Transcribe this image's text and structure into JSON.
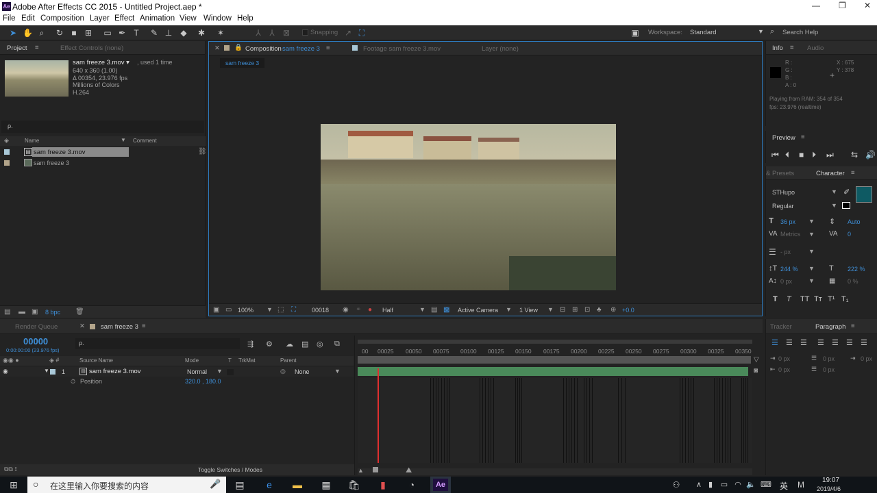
{
  "window": {
    "title": "Adobe After Effects CC 2015 - Untitled Project.aep *",
    "app_icon": "Ae"
  },
  "menu": [
    "File",
    "Edit",
    "Composition",
    "Layer",
    "Effect",
    "Animation",
    "View",
    "Window",
    "Help"
  ],
  "toolbar": {
    "snapping": "Snapping",
    "workspace_label": "Workspace:",
    "workspace_value": "Standard",
    "search": "Search Help"
  },
  "project": {
    "tab": "Project",
    "tab2": "Effect Controls (none)",
    "item": {
      "name": "sam freeze 3.mov ▾",
      "used": ", used 1 time",
      "dims": "640 x 360 (1.00)",
      "duration": "Δ 00354, 23.976 fps",
      "colors": "Millions of Colors",
      "codec": "H.264"
    },
    "search_placeholder": "ρ.",
    "columns": {
      "name": "Name",
      "comment": "Comment"
    },
    "rows": [
      "sam freeze 3.mov",
      "sam freeze 3"
    ],
    "bpc": "8 bpc"
  },
  "comp": {
    "tab": "Composition",
    "tab_name": "sam freeze 3",
    "footage_tab": "Footage sam freeze 3.mov",
    "layer_tab": "Layer (none)",
    "breadcrumb": "sam freeze 3",
    "zoom": "100%",
    "timecode": "00018",
    "resolution": "Half",
    "camera": "Active Camera",
    "views": "1 View",
    "exposure": "+0.0"
  },
  "info": {
    "tab": "Info",
    "tab2": "Audio",
    "r": "R :",
    "g": "G :",
    "b": "B :",
    "a": "A : 0",
    "x": "X : 675",
    "y": "Y : 378",
    "ram": "Playing from RAM: 354 of 354",
    "fps": "fps: 23.976 (realtime)"
  },
  "preview": {
    "title": "Preview"
  },
  "character": {
    "tab_left": "& Presets",
    "tab": "Character",
    "font": "STHupo",
    "style": "Regular",
    "size": "36 px",
    "leading": "Auto",
    "kerning": "Metrics",
    "tracking": "0",
    "stroke": "- px",
    "vscale": "244 %",
    "hscale": "222 %",
    "baseline": "0 px",
    "tsume": "0 %"
  },
  "timeline": {
    "tab_render": "Render Queue",
    "tab_comp": "sam freeze 3",
    "timecode": "00000",
    "timecode_sub": "0:00:00:00 (23.976 fps)",
    "columns": {
      "source": "Source Name",
      "mode": "Mode",
      "t": "T",
      "trkmat": "TrkMat",
      "parent": "Parent"
    },
    "layer": {
      "num": "1",
      "name": "sam freeze 3.mov",
      "mode": "Normal",
      "parent": "None"
    },
    "prop": {
      "name": "Position",
      "value": "320.0 , 180.0"
    },
    "ticks": [
      "00",
      "00025",
      "00050",
      "00075",
      "00100",
      "00125",
      "00150",
      "00175",
      "00200",
      "00225",
      "00250",
      "00275",
      "00300",
      "00325",
      "00350"
    ],
    "toggle": "Toggle Switches / Modes"
  },
  "tracker": {
    "tab": "Tracker",
    "tab2": "Paragraph",
    "v1": "0 px",
    "v2": "0 px",
    "v3": "0 px",
    "v4": "0 px",
    "v5": "0 px"
  },
  "taskbar": {
    "search": "在这里输入你要搜索的内容",
    "time": "19:07",
    "date": "2019/4/6",
    "ime": "英"
  }
}
